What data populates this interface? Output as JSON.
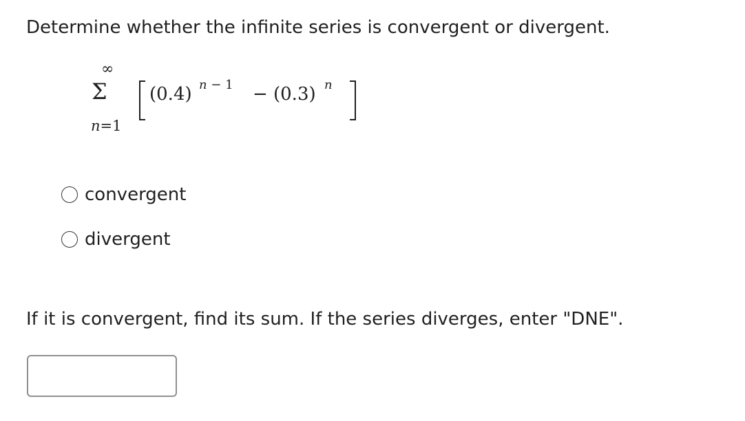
{
  "question": {
    "text": "Determine whether the infinite series is convergent or divergent."
  },
  "series": {
    "upper_limit": "∞",
    "sigma": "Σ",
    "lower_index": "n",
    "lower_eq": "=1",
    "term1_base": "(0.4)",
    "term1_exp_var": "n",
    "term1_exp_rest": " − 1",
    "operator": "−",
    "term2_base": "(0.3)",
    "term2_exp": "n"
  },
  "options": [
    {
      "label": "convergent",
      "selected": false
    },
    {
      "label": "divergent",
      "selected": false
    }
  ],
  "instruction": {
    "text": "If it is convergent, find its sum. If the series diverges, enter \"DNE\"."
  },
  "answer": {
    "value": "",
    "placeholder": ""
  }
}
